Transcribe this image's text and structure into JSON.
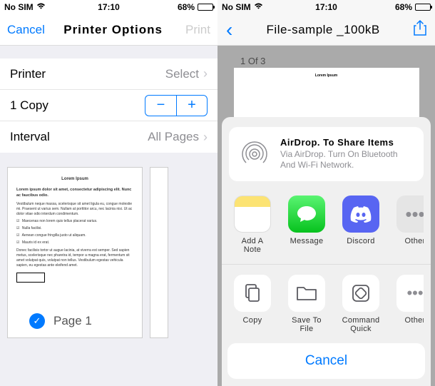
{
  "left": {
    "status": {
      "carrier": "No SIM",
      "time": "17:10",
      "battery_pct": "68%"
    },
    "nav": {
      "cancel": "Cancel",
      "title": "Printer Options",
      "print": "Print"
    },
    "rows": {
      "printer_label": "Printer",
      "printer_value": "Select",
      "copies": "1 Copy",
      "interval_label": "Interval",
      "interval_value": "All Pages"
    },
    "preview": {
      "page_label": "Page 1",
      "thumb_title": "Lorem Ipsum"
    }
  },
  "right": {
    "status": {
      "carrier": "No SIM",
      "time": "17:10",
      "battery_pct": "68%"
    },
    "nav": {
      "title": "File-sample _100kB"
    },
    "doc": {
      "counter": "1 Of 3",
      "title": "Lorem Ipsum"
    },
    "sheet": {
      "airdrop_title": "AirDrop. To Share Items",
      "airdrop_sub": "Via AirDrop. Turn On Bluetooth And Wi-Fi Network.",
      "apps": [
        {
          "key": "notes",
          "label": "Add A Note"
        },
        {
          "key": "message",
          "label": "Message"
        },
        {
          "key": "discord",
          "label": "Discord"
        },
        {
          "key": "other",
          "label": "Other"
        }
      ],
      "actions": [
        {
          "key": "copy",
          "label": "Copy"
        },
        {
          "key": "save",
          "label": "Save To File"
        },
        {
          "key": "command",
          "label": "Command Quick"
        },
        {
          "key": "other2",
          "label": "Other"
        }
      ],
      "cancel": "Cancel"
    }
  }
}
